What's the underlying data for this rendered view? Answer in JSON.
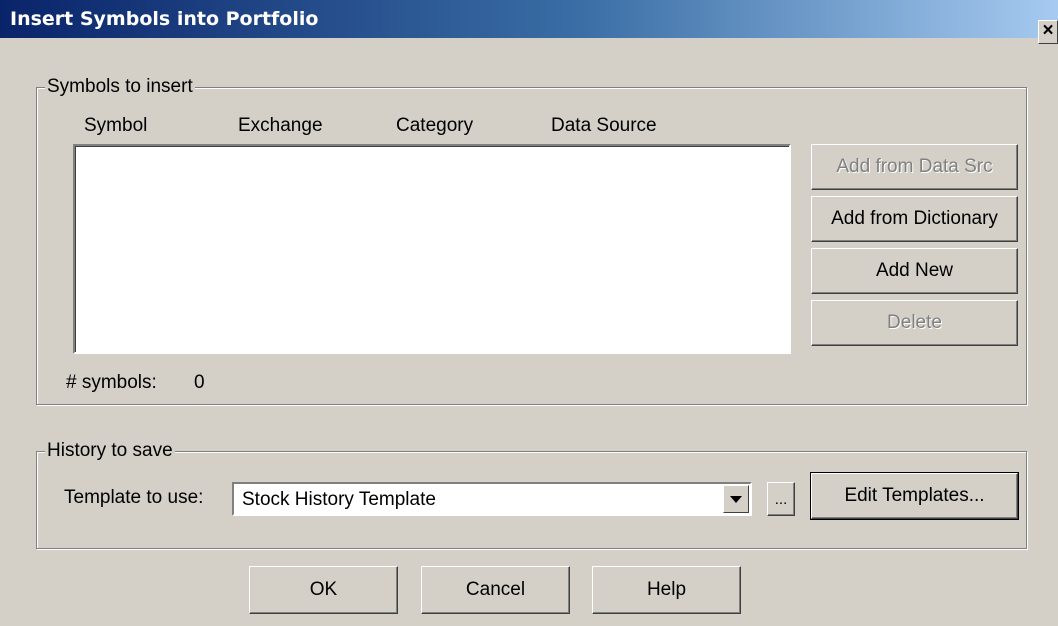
{
  "window": {
    "title": "Insert Symbols into Portfolio",
    "close_glyph": "×"
  },
  "symbols_group": {
    "label": "Symbols to insert",
    "columns": [
      "Symbol",
      "Exchange",
      "Category",
      "Data Source"
    ],
    "rows": [],
    "count_label": "# symbols:",
    "count_value": "0",
    "buttons": {
      "add_from_data_src": "Add from Data Src",
      "add_from_dictionary": "Add from Dictionary",
      "add_new": "Add New",
      "delete": "Delete"
    }
  },
  "history_group": {
    "label": "History to save",
    "template_label": "Template to use:",
    "template_value": "Stock History Template",
    "browse_label": "...",
    "edit_templates_label": "Edit Templates..."
  },
  "footer": {
    "ok_label": "OK",
    "cancel_label": "Cancel",
    "help_label": "Help"
  }
}
